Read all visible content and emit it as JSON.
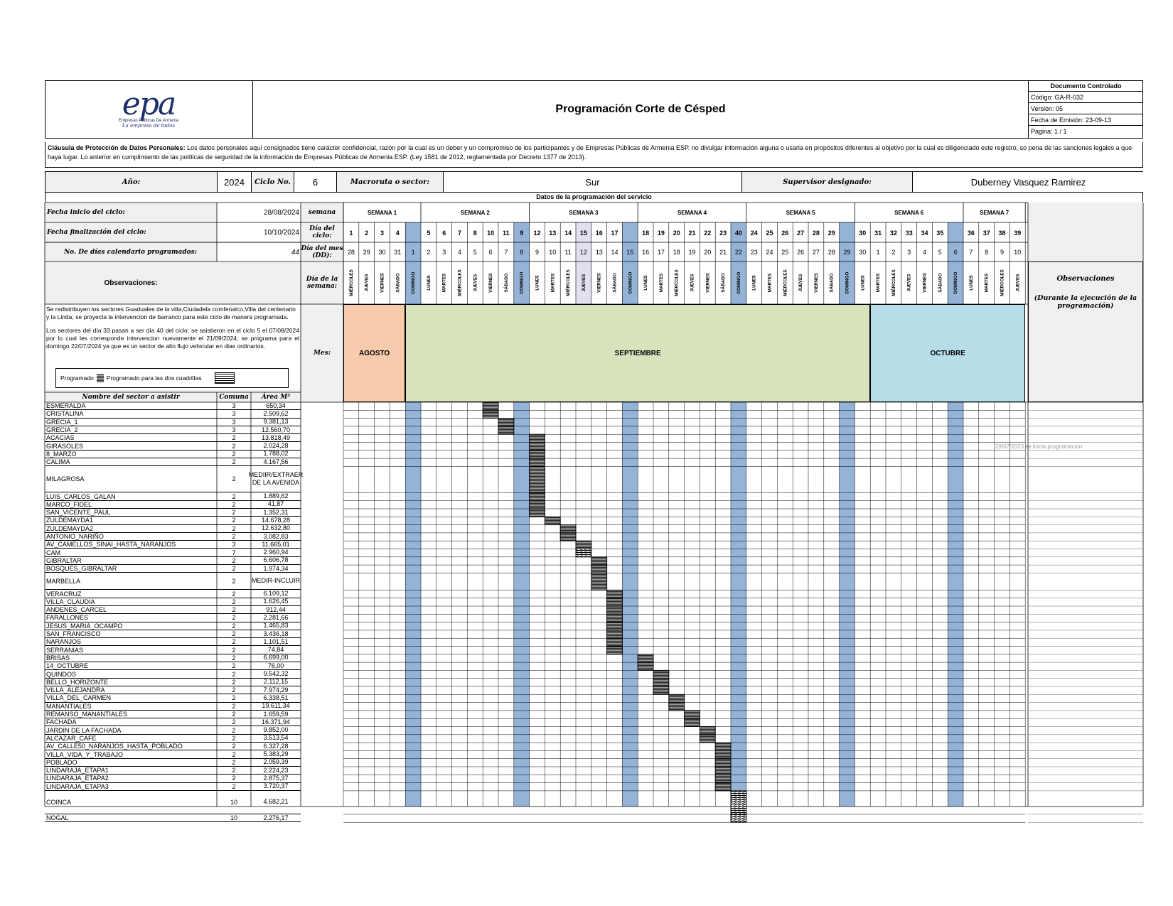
{
  "header": {
    "logo_text": "epa",
    "logo_sub": "Empresas Públicas De Armenia",
    "logo_tag": "La empresa de todos",
    "title": "Programación Corte de Césped",
    "meta": {
      "controlled": "Documento Controlado",
      "code": "Código: GA-R-032",
      "version": "Versión:  05",
      "issue_date": "Fecha de Emisión:  23-09-13",
      "page": "Pagina:  1 / 1"
    }
  },
  "clause": {
    "label": "Cláusula de Protección de Datos Personales:",
    "text": " Los datos personales aquí consignados tiene carácter confidencial, razón por la cual es un deber y un compromiso de los participantes y de Empresas Públicas de Armenia ESP. no divulgar información alguna o usarla en propósitos diferentes al objetivo por la cual es diligenciado este registro, so pena de las sanciones legales a que haya lugar.  Lo anterior en cumplimiento de las políticas de seguridad de la información de Empresas Públicas de Armenia ESP. (Ley 1581 de 2012, reglamentada por Decreto 1377 de 2013)."
  },
  "summary": {
    "year_label": "Año:",
    "year": "2024",
    "cycle_label": "Ciclo No.",
    "cycle": "6",
    "macro_label": "Macroruta o sector:",
    "macro": "Sur",
    "supervisor_label": "Supervisor designado:",
    "supervisor": "Duberney Vasquez Ramirez",
    "datos_title": "Datos de la programación del servicio",
    "start_label": "Fecha inicio del ciclo:",
    "start": "28/08/2024",
    "end_label": "Fecha finalización del ciclo:",
    "end": "10/10/2024",
    "days_label": "No. De días calendario programados:",
    "days": "44",
    "obs_label": "Observaciones:",
    "semana_label": "semana",
    "dia_ciclo_label": "Día del ciclo:",
    "dia_mes_label": "Día del mes (DD):",
    "dia_semana_label": "Día de la semana:",
    "mes_label": "Mes:"
  },
  "weeks": [
    "SEMANA 1",
    "SEMANA 2",
    "SEMANA 3",
    "SEMANA 4",
    "SEMANA 5",
    "SEMANA 6",
    "SEMANA 7"
  ],
  "cycle_days": [
    "1",
    "2",
    "3",
    "4",
    "",
    "5",
    "6",
    "7",
    "8",
    "10",
    "11",
    "9",
    "12",
    "13",
    "14",
    "15",
    "16",
    "17",
    "",
    "18",
    "19",
    "20",
    "21",
    "22",
    "23",
    "40",
    "24",
    "25",
    "26",
    "27",
    "28",
    "29",
    "",
    "30",
    "31",
    "32",
    "33",
    "34",
    "35",
    "",
    "36",
    "37",
    "38",
    "39"
  ],
  "month_days": [
    "28",
    "29",
    "30",
    "31",
    "1",
    "2",
    "3",
    "4",
    "5",
    "6",
    "7",
    "8",
    "9",
    "10",
    "11",
    "12",
    "13",
    "14",
    "15",
    "16",
    "17",
    "18",
    "19",
    "20",
    "21",
    "22",
    "23",
    "24",
    "25",
    "26",
    "27",
    "28",
    "29",
    "30",
    "1",
    "2",
    "3",
    "4",
    "5",
    "6",
    "7",
    "8",
    "9",
    "10"
  ],
  "weekdays": [
    "MIÉRCOLES",
    "JUEVES",
    "VIERNES",
    "SÁBADO",
    "DOMINGO",
    "LUNES",
    "MARTES",
    "MIÉRCOLES",
    "JUEVES",
    "VIERNES",
    "SÁBADO",
    "DOMINGO",
    "LUNES",
    "MARTES",
    "MIÉRCOLES",
    "JUEVES",
    "VIERNES",
    "SÁBADO",
    "DOMINGO",
    "LUNES",
    "MARTES",
    "MIÉRCOLES",
    "JUEVES",
    "VIERNES",
    "SÁBADO",
    "DOMINGO",
    "LUNES",
    "MARTES",
    "MIÉRCOLES",
    "JUEVES",
    "VIERNES",
    "SÁBADO",
    "DOMINGO",
    "LUNES",
    "MARTES",
    "MIÉRCOLES",
    "JUEVES",
    "VIERNES",
    "SÁBADO",
    "DOMINGO",
    "LUNES",
    "MARTES",
    "MIÉRCOLES",
    "JUEVES"
  ],
  "months": [
    {
      "name": "AGOSTO",
      "color": "#f8cbad"
    },
    {
      "name": "SEPTIEMBRE",
      "color": "#d6e3bc"
    },
    {
      "name": "OCTUBRE",
      "color": "#b7dde8"
    }
  ],
  "observations_text_1": "Se redistribuyen los sectores Guaduales de la villa,Ciudadela comfenalco,Villa del centenario y la Linda; se proyecta la intervencion de barranco para este ciclo de manera programada.",
  "observations_text_2": "Los sectores del día 33 pasan a ser día 40 del ciclo; se asistieron en el ciclo 5 el 07/08/2024 por lo cual les corresponde intervencion nuevamente el 21/09/2024; se programa para el domingo 22/07/2024 ya que es un sector de alto flujo vehicular en dias ordinarios.",
  "legend": {
    "programado": "Programado",
    "dos": "Programado para las dos cuadrillas"
  },
  "obs_right": {
    "title": "Observaciones",
    "subtitle": "(Durante la ejecución de la programación)"
  },
  "columns": {
    "name": "Nombre del sector a asistir",
    "comuna": "Comuna",
    "area": "Área M²"
  },
  "sunday_color": "#95b3d7",
  "note_row": "29/07/2023 se inicia programacion",
  "sectors": [
    {
      "name": "ESMERALDA",
      "comuna": "3",
      "area": "650,34"
    },
    {
      "name": "CRISTALINA",
      "comuna": "3",
      "area": "2.509,62"
    },
    {
      "name": "GRECIA_1",
      "comuna": "3",
      "area": "9.381,13"
    },
    {
      "name": "GRECIA_2",
      "comuna": "3",
      "area": "12.560,70"
    },
    {
      "name": "ACACIAS",
      "comuna": "2",
      "area": "13.818,49"
    },
    {
      "name": "GIRASOLES",
      "comuna": "2",
      "area": "2.024,28"
    },
    {
      "name": "8_MARZO",
      "comuna": "2",
      "area": "1.788,02"
    },
    {
      "name": "CALIMA",
      "comuna": "2",
      "area": "4.167,56"
    },
    {
      "name": "MILAGROSA",
      "comuna": "2",
      "area": "MEDIIR/EXTRAER DE LA AVENIDA",
      "tall": true
    },
    {
      "name": "LUIS_CARLOS_GALAN",
      "comuna": "2",
      "area": "1.889,62"
    },
    {
      "name": "MARCO_FIDEL",
      "comuna": "2",
      "area": "41,87"
    },
    {
      "name": "SAN_VICENTE_PAUL",
      "comuna": "2",
      "area": "1.352,31"
    },
    {
      "name": "ZULDEMAYDA1",
      "comuna": "2",
      "area": "14.678,28"
    },
    {
      "name": "ZULDEMAYDA2",
      "comuna": "2",
      "area": "12.632,80"
    },
    {
      "name": "ANTONIO_NARIÑO",
      "comuna": "2",
      "area": "3.082,83"
    },
    {
      "name": "AV_CAMELLOS_SINAI_HASTA_NARANJOS",
      "comuna": "3",
      "area": "11.665,01"
    },
    {
      "name": "CAM",
      "comuna": "7",
      "area": "2.960,94"
    },
    {
      "name": "GIBRALTAR",
      "comuna": "2",
      "area": "6.606,78"
    },
    {
      "name": "BOSQUES_GIBRALTAR",
      "comuna": "2",
      "area": "1.974,34"
    },
    {
      "name": "MARBELLA",
      "comuna": "2",
      "area": "MEDIR-INCLUIR",
      "tall2": true
    },
    {
      "name": "VERACRUZ",
      "comuna": "2",
      "area": "6.109,12"
    },
    {
      "name": "VILLA_CLAUDIA",
      "comuna": "2",
      "area": "1.626,45"
    },
    {
      "name": "ANDENES_CARCEL",
      "comuna": "2",
      "area": "912,44"
    },
    {
      "name": "FARALLONES",
      "comuna": "2",
      "area": "2.281,66"
    },
    {
      "name": "JESUS_MARIA_OCAMPO",
      "comuna": "2",
      "area": "1.465,83"
    },
    {
      "name": "SAN_FRANCISCO",
      "comuna": "2",
      "area": "3.436,18"
    },
    {
      "name": "NARANJOS",
      "comuna": "2",
      "area": "1.101,51"
    },
    {
      "name": "SERRANIAS",
      "comuna": "2",
      "area": "74,84"
    },
    {
      "name": "BRISAS",
      "comuna": "2",
      "area": "6.699,00"
    },
    {
      "name": "14_OCTUBRE",
      "comuna": "2",
      "area": "76,00"
    },
    {
      "name": "QUINDOS",
      "comuna": "2",
      "area": "9.542,32"
    },
    {
      "name": "BELLO_HORIZONTE",
      "comuna": "2",
      "area": "2.112,15"
    },
    {
      "name": "VILLA_ALEJANDRA",
      "comuna": "2",
      "area": "7.974,29"
    },
    {
      "name": "VILLA_DEL_CARMEN",
      "comuna": "2",
      "area": "6.338,51"
    },
    {
      "name": "MANANTIALES",
      "comuna": "2",
      "area": "19.611,34"
    },
    {
      "name": "REMANSO_MANANTIALES",
      "comuna": "2",
      "area": "1.659,59"
    },
    {
      "name": "FACHADA",
      "comuna": "2",
      "area": "16.371,94"
    },
    {
      "name": "JARDIN DE LA FACHADA",
      "comuna": "2",
      "area": "9.852,00"
    },
    {
      "name": "ALCAZAR_CAFE",
      "comuna": "2",
      "area": "3.513,54"
    },
    {
      "name": "AV_CALLE50_NARANJOS_HASTA_POBLADO",
      "comuna": "2",
      "area": "6.327,28"
    },
    {
      "name": "VILLA_VIDA_Y_TRABAJO",
      "comuna": "2",
      "area": "5.383,29"
    },
    {
      "name": "POBLADO",
      "comuna": "2",
      "area": "2.059,39"
    },
    {
      "name": "LINDARAJA_ETAPA1",
      "comuna": "2",
      "area": "2.224,23"
    },
    {
      "name": "LINDARAJA_ETAPA2",
      "comuna": "2",
      "area": "2.875,37"
    },
    {
      "name": "LINDARAJA_ETAPA3",
      "comuna": "2",
      "area": "3.720,37"
    },
    {
      "name": "COINCA",
      "comuna": "10",
      "area": "4.682,21",
      "tall3": true
    },
    {
      "name": "NOGAL",
      "comuna": "10",
      "area": "2.276,17"
    }
  ],
  "schedule": [
    {
      "row": 0,
      "col": 9
    },
    {
      "row": 1,
      "col": 9
    },
    {
      "row": 2,
      "col": 10
    },
    {
      "row": 3,
      "col": 10
    },
    {
      "row": 4,
      "col": 12
    },
    {
      "row": 5,
      "col": 12
    },
    {
      "row": 6,
      "col": 12
    },
    {
      "row": 7,
      "col": 12
    },
    {
      "row": 8,
      "col": 12
    },
    {
      "row": 9,
      "col": 12
    },
    {
      "row": 10,
      "col": 12
    },
    {
      "row": 11,
      "col": 12
    },
    {
      "row": 12,
      "col": 13
    },
    {
      "row": 13,
      "col": 14
    },
    {
      "row": 14,
      "col": 14
    },
    {
      "row": 15,
      "col": 15
    },
    {
      "row": 16,
      "col": 15,
      "dual": true
    },
    {
      "row": 17,
      "col": 16
    },
    {
      "row": 18,
      "col": 16
    },
    {
      "row": 19,
      "col": 16
    },
    {
      "row": 20,
      "col": 17
    },
    {
      "row": 21,
      "col": 17
    },
    {
      "row": 22,
      "col": 17
    },
    {
      "row": 23,
      "col": 17
    },
    {
      "row": 24,
      "col": 17
    },
    {
      "row": 25,
      "col": 17
    },
    {
      "row": 26,
      "col": 17
    },
    {
      "row": 27,
      "col": 17
    },
    {
      "row": 28,
      "col": 19
    },
    {
      "row": 29,
      "col": 19
    },
    {
      "row": 30,
      "col": 20
    },
    {
      "row": 31,
      "col": 20
    },
    {
      "row": 32,
      "col": 20
    },
    {
      "row": 33,
      "col": 21
    },
    {
      "row": 34,
      "col": 21
    },
    {
      "row": 35,
      "col": 22
    },
    {
      "row": 36,
      "col": 22
    },
    {
      "row": 37,
      "col": 23
    },
    {
      "row": 38,
      "col": 23
    },
    {
      "row": 39,
      "col": 24
    },
    {
      "row": 40,
      "col": 24
    },
    {
      "row": 41,
      "col": 24
    },
    {
      "row": 42,
      "col": 24
    },
    {
      "row": 43,
      "col": 24
    },
    {
      "row": 44,
      "col": 24
    },
    {
      "row": 45,
      "col": 25,
      "dual": true
    },
    {
      "row": 46,
      "col": 25,
      "dual": true
    }
  ]
}
